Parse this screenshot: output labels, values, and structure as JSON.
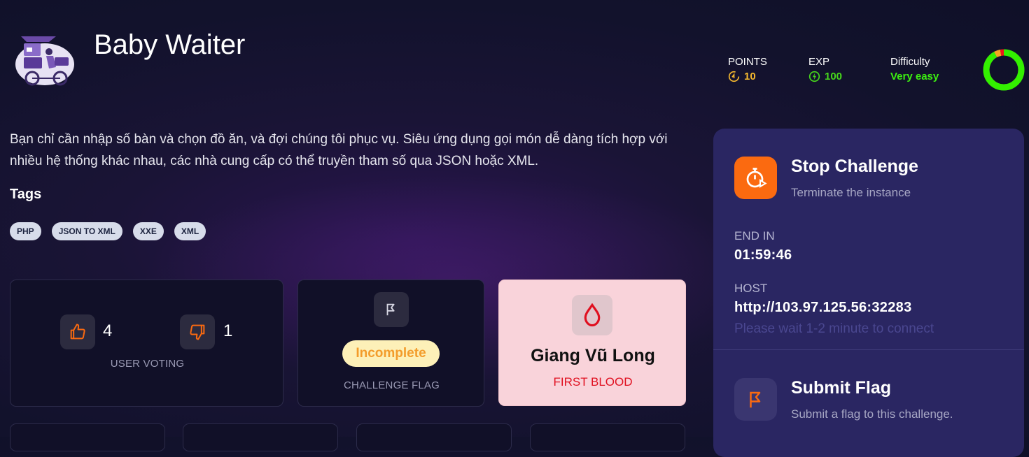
{
  "challenge": {
    "title": "Baby Waiter",
    "description": "Bạn chỉ cần nhập số bàn và chọn đồ ăn, và đợi chúng tôi phục vụ. Siêu ứng dụng gọi món dễ dàng tích hợp với nhiều hệ thống khác nhau, các nhà cung cấp có thể truyền tham số qua JSON hoặc XML."
  },
  "stats": {
    "points_label": "POINTS",
    "points_value": "10",
    "exp_label": "EXP",
    "exp_value": "100",
    "difficulty_label": "Difficulty",
    "difficulty_value": "Very easy"
  },
  "tags": {
    "title": "Tags",
    "items": [
      "PHP",
      "JSON TO XML",
      "XXE",
      "XML"
    ]
  },
  "voting": {
    "likes": "4",
    "dislikes": "1",
    "label": "USER VOTING"
  },
  "flag_status": {
    "status": "Incomplete",
    "label": "CHALLENGE FLAG"
  },
  "first_blood": {
    "name": "Giang Vũ Long",
    "label": "FIRST BLOOD"
  },
  "instance": {
    "stop_title": "Stop Challenge",
    "stop_subtitle": "Terminate the instance",
    "end_in_label": "END IN",
    "end_in_value": "01:59:46",
    "host_label": "HOST",
    "host_value": "http://103.97.125.56:32283",
    "host_hint": "Please wait 1-2 minute to connect"
  },
  "submit": {
    "title": "Submit Flag",
    "subtitle": "Submit a flag to this challenge."
  },
  "colors": {
    "points": "#f5b82e",
    "exp": "#47d81c",
    "difficulty": "#3cf010",
    "accent_orange": "#fb6a10",
    "first_blood_red": "#e01020"
  },
  "difficulty_ring": {
    "green_fraction": 0.92,
    "orange_fraction": 0.05,
    "red_fraction": 0.03
  }
}
